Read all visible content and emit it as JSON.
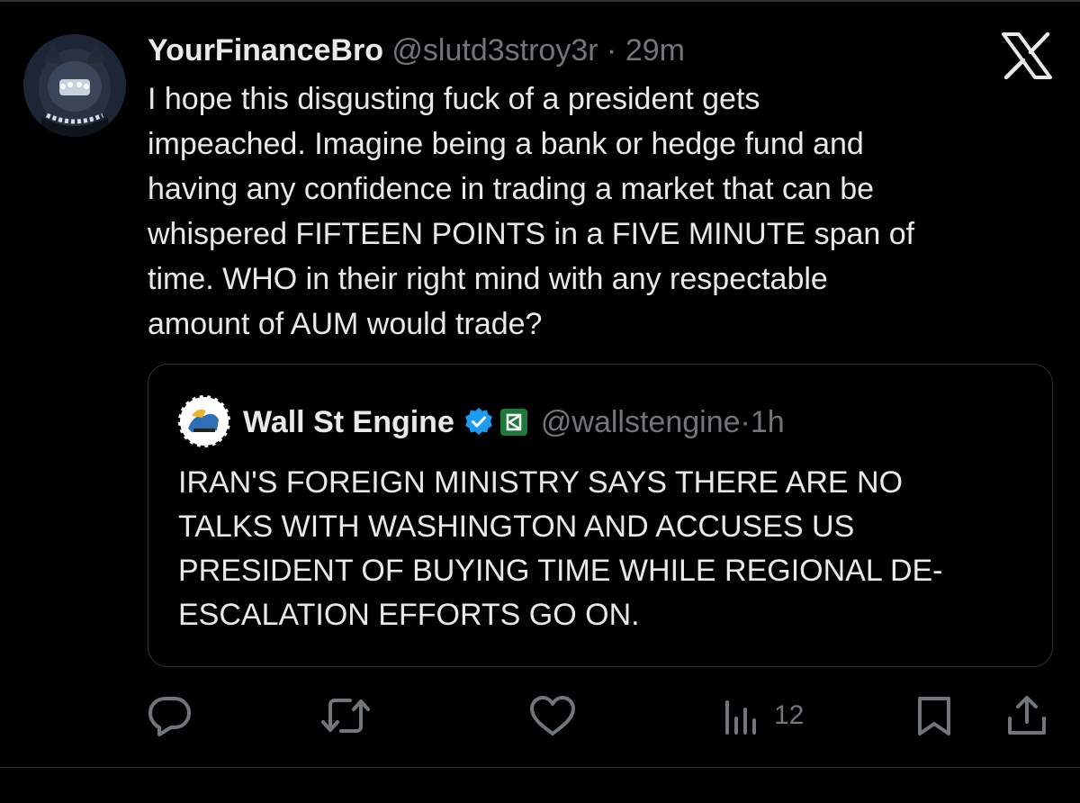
{
  "tweet": {
    "display_name": "YourFinanceBro",
    "handle": "@slutd3stroy3r",
    "separator": "·",
    "time": "29m",
    "text_lines": [
      "I hope this disgusting fuck of a president gets",
      "impeached. Imagine being a bank or hedge fund and",
      "having any confidence in trading a market that can be",
      "whispered FIFTEEN POINTS in a FIVE MINUTE span of",
      "time. WHO in their right mind with any respectable",
      "amount of AUM would trade?"
    ]
  },
  "quote": {
    "display_name": "Wall St Engine",
    "handle": "@wallstengine",
    "separator": "·",
    "time": "1h",
    "text_lines": [
      "IRAN'S FOREIGN MINISTRY SAYS THERE ARE NO",
      "TALKS WITH WASHINGTON AND ACCUSES US",
      "PRESIDENT OF BUYING TIME WHILE REGIONAL DE-",
      "ESCALATION EFFORTS GO ON."
    ]
  },
  "actions": {
    "views_count": "12",
    "icons": [
      "reply-icon",
      "retweet-icon",
      "like-icon",
      "views-icon",
      "bookmark-icon",
      "share-icon"
    ]
  },
  "colors": {
    "background": "#000000",
    "text": "#e7e9ea",
    "muted": "#71767b",
    "border": "#2f3336",
    "verified": "#1d9bf0",
    "affiliate": "#1f7a3a"
  }
}
